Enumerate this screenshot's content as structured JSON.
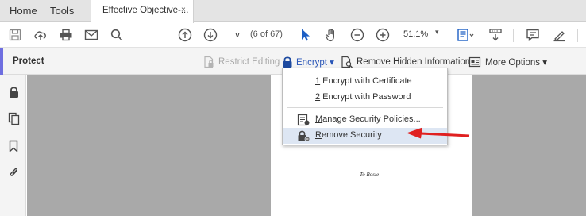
{
  "tabs": {
    "home": "Home",
    "tools": "Tools",
    "document": "Effective Objective-...",
    "close": "×"
  },
  "toolbar": {
    "page_input": "v",
    "page_count": "(6 of 67)",
    "zoom": "51.1%",
    "zoom_dropdown": "▾"
  },
  "protect_bar": {
    "title": "Protect",
    "restrict_editing": "Restrict Editing",
    "encrypt": "Encrypt ▾",
    "remove_hidden": "Remove Hidden Information",
    "more_options": "More Options ▾"
  },
  "encrypt_menu": {
    "items": [
      {
        "key": "1",
        "label": " Encrypt with Certificate"
      },
      {
        "key": "2",
        "label": " Encrypt with Password"
      },
      {
        "key": "M",
        "label": "anage Security Policies..."
      },
      {
        "key": "R",
        "label": "emove Security"
      }
    ]
  },
  "page": {
    "dedication": "To Rosie"
  },
  "colors": {
    "accent": "#6e6ee0",
    "link_blue": "#2a56b8",
    "arrow_red": "#e02020",
    "doc_background": "#a9a9a9"
  }
}
